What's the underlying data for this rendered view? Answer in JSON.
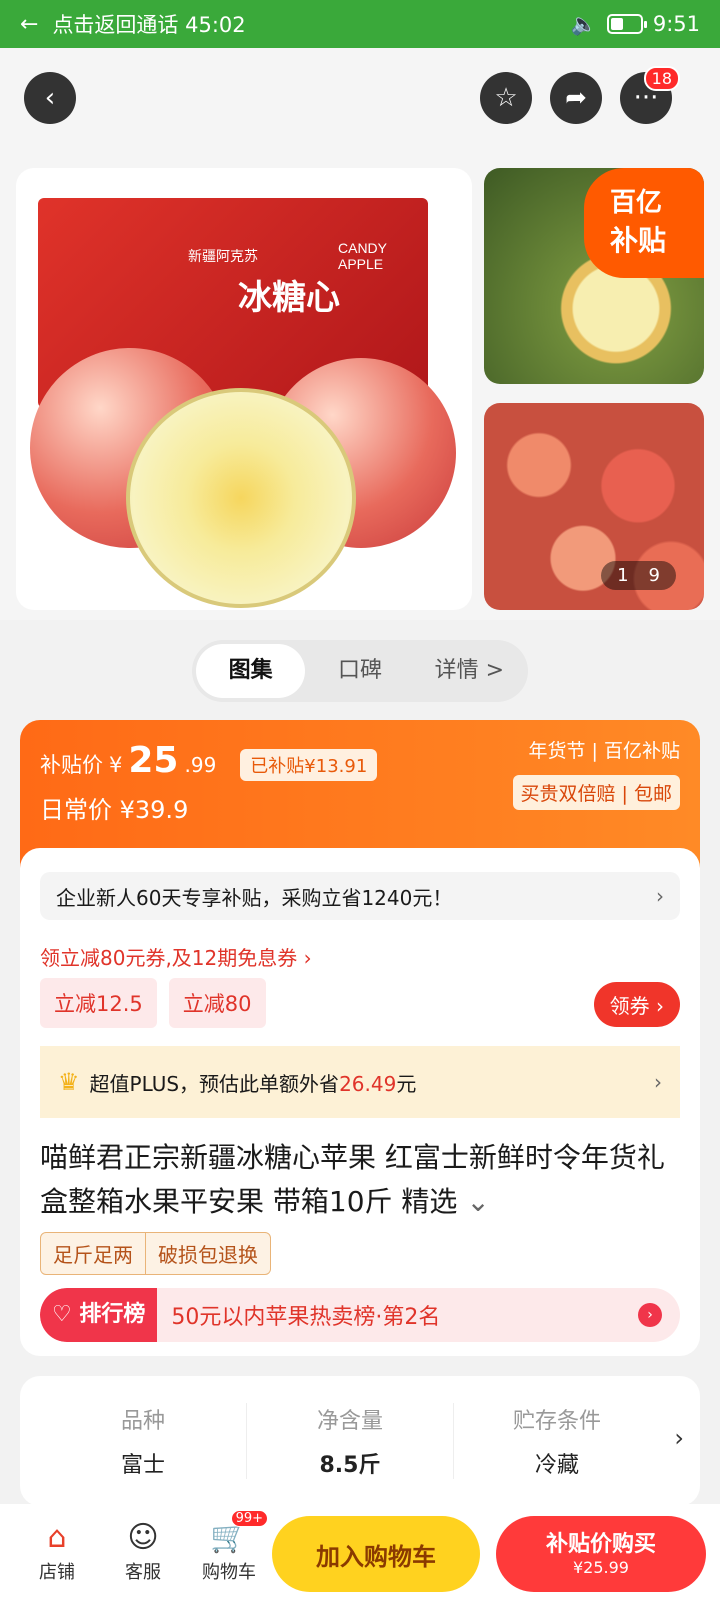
{
  "status_bar": {
    "call_text": "点击返回通话 45:02",
    "time": "9:51"
  },
  "nav": {
    "cart_badge": "18"
  },
  "gallery": {
    "box_brand": "新疆阿克苏",
    "box_small": "CANDY APPLE",
    "box_title": "冰糖心",
    "subsidy_line1": "百亿",
    "subsidy_line2": "补贴",
    "counter_current": "1",
    "counter_total": "9"
  },
  "tabs": [
    "图集",
    "口碑",
    "详情 >"
  ],
  "price": {
    "subsidy_label": "补贴价",
    "currency": "¥",
    "amount": "25",
    "decimal": ".99",
    "saved": "已补贴¥13.91",
    "regular": "日常价 ¥39.9",
    "brand_tags": "年货节 | 百亿补贴",
    "guarantee": "买贵双倍赔 | 包邮"
  },
  "promo": {
    "notice": "企业新人60天专享补贴，采购立省1240元！",
    "coupon_line": "领立减80元券,及12期免息券 ›",
    "chips": [
      "立减12.5",
      "立减80"
    ],
    "get_coupon": "领券 ›",
    "plus_prefix": "超值PLUS，预估此单额外省",
    "plus_amount": "26.49",
    "plus_suffix": "元"
  },
  "product": {
    "title": "喵鲜君正宗新疆冰糖心苹果 红富士新鲜时令年货礼盒整箱水果平安果 带箱10斤 精选",
    "tags": [
      "足斤足两",
      "破损包退换"
    ],
    "rank_head": "排行榜",
    "rank_text": "50元以内苹果热卖榜·第2名"
  },
  "attributes": [
    {
      "key": "品种",
      "value": "富士"
    },
    {
      "key": "净含量",
      "value": "8.5斤"
    },
    {
      "key": "贮存条件",
      "value": "冷藏"
    }
  ],
  "bottom": {
    "shop": "店铺",
    "service": "客服",
    "cart": "购物车",
    "cart_badge": "99+",
    "add_cart": "加入购物车",
    "buy_now": "补贴价购买",
    "buy_price": "¥25.99"
  },
  "colors": {
    "status_green": "#3aa93a",
    "accent_orange": "#ff6a16",
    "accent_red": "#f0352a",
    "cart_yellow": "#ffd21f"
  }
}
